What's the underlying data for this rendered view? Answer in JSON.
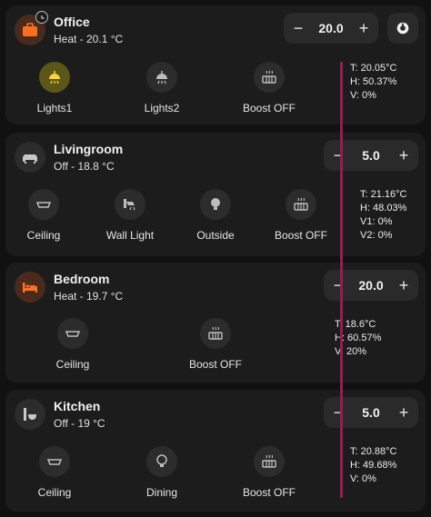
{
  "rooms": [
    {
      "name": "Office",
      "status": "Heat - 20.1 °C",
      "icon": "briefcase-icon",
      "setpoint": "20.0",
      "devices": [
        {
          "label": "Lights1",
          "icon": "ceiling-light-icon",
          "on": true
        },
        {
          "label": "Lights2",
          "icon": "ceiling-light-icon",
          "on": false
        },
        {
          "label": "Boost OFF",
          "icon": "radiator-icon",
          "on": false
        }
      ],
      "readings": [
        "T: 20.05°C",
        "H: 50.37%",
        "V: 0%"
      ]
    },
    {
      "name": "Livingroom",
      "status": "Off - 18.8 °C",
      "icon": "sofa-icon",
      "setpoint": "5.0",
      "devices": [
        {
          "label": "Ceiling",
          "icon": "ceiling-light-icon",
          "on": false
        },
        {
          "label": "Wall Light",
          "icon": "wall-light-icon",
          "on": false
        },
        {
          "label": "Outside",
          "icon": "bulb-icon",
          "on": false
        },
        {
          "label": "Boost OFF",
          "icon": "radiator-icon",
          "on": false
        }
      ],
      "readings": [
        "T: 21.16°C",
        "H: 48.03%",
        "V1: 0%",
        "V2: 0%"
      ]
    },
    {
      "name": "Bedroom",
      "status": "Heat - 19.7 °C",
      "icon": "bed-icon",
      "setpoint": "20.0",
      "devices": [
        {
          "label": "Ceiling",
          "icon": "ceiling-light-icon",
          "on": false
        },
        {
          "label": "Boost OFF",
          "icon": "radiator-icon",
          "on": false
        }
      ],
      "readings": [
        "T: 18.6°C",
        "H: 60.57%",
        "V: 20%"
      ]
    },
    {
      "name": "Kitchen",
      "status": "Off - 19 °C",
      "icon": "kitchen-icon",
      "setpoint": "5.0",
      "devices": [
        {
          "label": "Ceiling",
          "icon": "ceiling-light-icon",
          "on": false
        },
        {
          "label": "Dining",
          "icon": "bulb-icon",
          "on": false
        },
        {
          "label": "Boost OFF",
          "icon": "radiator-icon",
          "on": false
        }
      ],
      "readings": [
        "T: 20.88°C",
        "H: 49.68%",
        "V: 0%"
      ]
    }
  ],
  "controls": {
    "minus": "−",
    "plus": "+"
  },
  "colors": {
    "background": "#111111",
    "card": "#1c1c1c",
    "accent_orange": "#ff6f22",
    "light_on": "#f5d73a",
    "divider": "#9b1c4b"
  }
}
